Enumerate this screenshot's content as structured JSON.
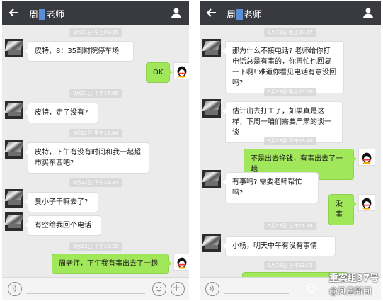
{
  "left_chat": {
    "title_prefix": "周",
    "title_suffix": "老师",
    "timestamps": [
      "9月21日 早上05:15",
      "9月21日 下午17:08",
      "9月22日 早午12:44",
      "9月23日 下午16:24",
      "9月23日 下午16:29"
    ],
    "messages": [
      {
        "text": "皮特，8：35到财院停车场"
      },
      {
        "text": "OK"
      },
      {
        "text": "皮特，走了没有?"
      },
      {
        "text": "皮特，下午有没有时间和我一起超市买东西吧?"
      },
      {
        "text": "臭小子干嘛去了?"
      },
      {
        "text": "有空给我回个电话"
      },
      {
        "text": "周老师，下午我有事出去了一趟"
      }
    ]
  },
  "right_chat": {
    "title_prefix": "周",
    "title_suffix": "老师",
    "timestamps": [
      "9月22日 晚上20:17",
      "9月23日 晚上20:50",
      "9月23日 下午16:40",
      "9月23日 上午11:48",
      "9月28日 下午13:05"
    ],
    "messages": [
      {
        "text": "那为什么不接电话? 老师给你打电话总是有事的，你再忙也回复一下啊! 难道你看见电话有意没回吗?"
      },
      {
        "text": "估计出去打工了，如果真是这样，下周一咱们需要严肃的谈一谈"
      },
      {
        "text": "不是出去挣钱，有事出去了一趟"
      },
      {
        "text": "有事吗? 需要老师帮忙吗?"
      },
      {
        "text": "没事"
      },
      {
        "text": "小杨，明天中午有没有事情"
      }
    ]
  },
  "watermark": {
    "line1": "重案组37号",
    "line2": "@凤凰新闻"
  },
  "colors": {
    "titlebar": "#393a3f",
    "chat_bg": "#ebebeb",
    "bubble_out": "#a0e75a",
    "bubble_in": "#ffffff"
  },
  "icons": [
    "back-arrow-icon",
    "person-icon",
    "voice-icon",
    "emoji-icon",
    "plus-icon",
    "qq-penguin-icon"
  ]
}
